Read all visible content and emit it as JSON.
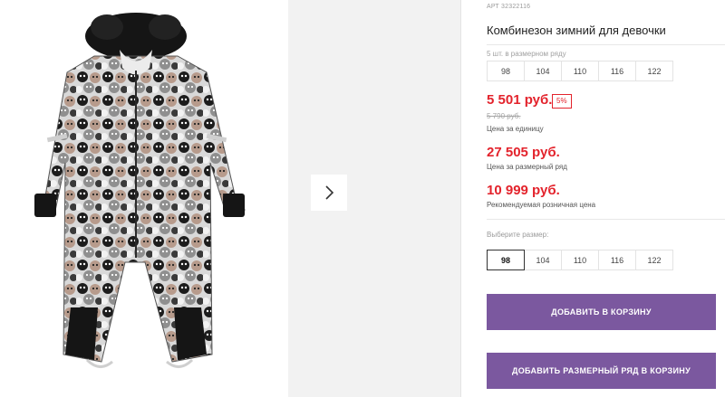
{
  "product": {
    "article": "АРТ 32322116",
    "title": "Комбинезон зимний для девочки"
  },
  "size_row": {
    "note": "5 шт. в размерном ряду",
    "sizes": [
      "98",
      "104",
      "110",
      "116",
      "122"
    ]
  },
  "prices": {
    "unit_price": "5 501 руб.",
    "discount_badge": "5%",
    "old_price": "5 790 руб.",
    "unit_label": "Цена за единицу",
    "row_price": "27 505 руб.",
    "row_label": "Цена за размерный ряд",
    "retail_price": "10 999 руб.",
    "retail_label": "Рекомендуемая розничная цена"
  },
  "size_select": {
    "label": "Выберите размер:",
    "options": [
      "98",
      "104",
      "110",
      "116",
      "122"
    ],
    "selected": "98"
  },
  "buttons": {
    "add_to_cart": "ДОБАВИТЬ В КОРЗИНУ",
    "add_row_to_cart": "ДОБАВИТЬ РАЗМЕРНЫЙ РЯД В КОРЗИНУ"
  },
  "colors": {
    "price_red": "#e3232c",
    "button_purple": "#7b589f"
  },
  "icons": {
    "next": "chevron-right-icon"
  }
}
